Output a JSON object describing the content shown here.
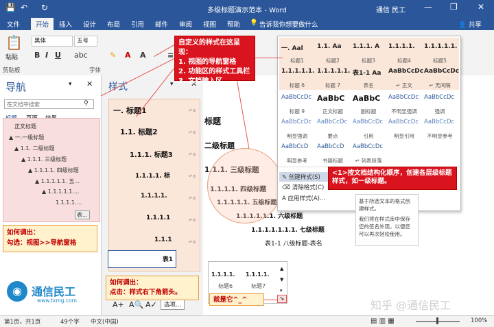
{
  "window": {
    "title": "多级标题演示范本 - Word",
    "user": "通信 民工",
    "share": "共享"
  },
  "tabs": [
    "文件",
    "开始",
    "插入",
    "设计",
    "布局",
    "引用",
    "邮件",
    "审阅",
    "视图",
    "帮助"
  ],
  "tell_me": "告诉我你想要做什么",
  "ribbon": {
    "paste": "粘贴",
    "clipboard": "剪贴板",
    "font_name": "黑体",
    "font_size": "五号",
    "font_group": "字体"
  },
  "nav_pane": {
    "title": "导航",
    "search_placeholder": "在文档中搜索",
    "tabs": [
      "标题",
      "页面",
      "结果"
    ],
    "items": [
      "正文标题",
      "▲ 一.一级标题",
      "▲ 1.1. 二级标题",
      "▲ 1.1.1. 三级标题",
      "▲ 1.1.1.1. 四级标题",
      "▲ 1.1.1.1.1. 五...",
      "▲ 1.1.1.1.1....",
      "1.1.1.1....",
      "表..."
    ]
  },
  "styles_pane": {
    "title": "样式",
    "items": [
      "一. 标题1",
      "1.1. 标题2",
      "1.1.1. 标题3",
      "1.1.1.1. 标",
      "1.1.1.1.",
      "1.1.1.1",
      "1.1.1",
      "表1"
    ],
    "options": "选项..."
  },
  "document": {
    "lines": [
      "标题",
      "二级标题",
      "1.1.1. 三级标题",
      "1.1.1.1. 四级标题",
      "1.1.1.1.1. 五级标题",
      "1.1.1.1.1.1. 六级标题",
      "1.1.1.1.1.1.1. 七级标题",
      "表1-1 八级标题-表名"
    ]
  },
  "gallery": {
    "row1": [
      {
        "preview": "一. Aal",
        "name": "标题1"
      },
      {
        "preview": "1.1. Aa",
        "name": "标题2"
      },
      {
        "preview": "1.1.1. A",
        "name": "标题3"
      },
      {
        "preview": "1.1.1.1.",
        "name": "标题4"
      },
      {
        "preview": "1.1.1.1.1.",
        "name": "标题5"
      }
    ],
    "row2": [
      {
        "preview": "1.1.1.1.1.",
        "name": "标题 6"
      },
      {
        "preview": "1.1.1.1.1.",
        "name": "标题 7"
      },
      {
        "preview": "表1-1 Aa",
        "name": "表名"
      },
      {
        "preview": "AaBbCcDc",
        "name": "↵ 正文"
      },
      {
        "preview": "AaBbCcDc",
        "name": "↵ 无间隔"
      }
    ],
    "row3": [
      {
        "preview": "AaBbCcDc",
        "name": "标题 9"
      },
      {
        "preview": "AaBbC",
        "name": "正文标题"
      },
      {
        "preview": "AaBbC",
        "name": "副标题"
      },
      {
        "preview": "AaBbCcDc",
        "name": "不明显强调"
      },
      {
        "preview": "AaBbCcDc",
        "name": "强调"
      }
    ],
    "row4": [
      {
        "preview": "AaBbCcDc",
        "name": "明显强调"
      },
      {
        "preview": "AaBbCcDc",
        "name": "要点"
      },
      {
        "preview": "AaBbCcDc",
        "name": "引用"
      },
      {
        "preview": "AaBbCcDc",
        "name": "明显引用"
      },
      {
        "preview": "AaBbCcDc",
        "name": "不明显参考"
      }
    ],
    "row5": [
      {
        "preview": "AaBbCcD",
        "name": "明显参考"
      },
      {
        "preview": "AaBbCcD",
        "name": "书籍标题"
      },
      {
        "preview": "AaBbCcDc",
        "name": "↵ 列表段落"
      }
    ],
    "menu": [
      "创建样式(S)",
      "清除格式(C)",
      "应用样式(A)..."
    ]
  },
  "tooltip": {
    "line1": "基于所选文本的格式创建样式。",
    "line2": "我们将在样式库中保存您的签名外观，以便您可以再次轻松使用。"
  },
  "small_gallery": [
    {
      "preview": "1.1.1.1.",
      "name": "标题6"
    },
    {
      "preview": "1.1.1.1.",
      "name": "标题7"
    }
  ],
  "annotations": {
    "main": "自定义的样式在这呈现：\n1. 视图的导航窗格\n2. 功能区的样式工具栏\n3. 文档输入区",
    "order": "<1>按文档结构化顺序，创建各层级标题样式，如一级标题。",
    "nav_how": "如何调出：\n勾选：视图>>导航窗格",
    "style_how": "如何调出：\n点击：样式右下角箭头。",
    "arrow": "就是它^_^"
  },
  "logo": {
    "name": "通信民工",
    "url": "www.txmg.com"
  },
  "watermark": "知乎 @通信民工",
  "status": {
    "page": "第1页，共1页",
    "words": "49个字",
    "lang": "中文(中国)",
    "zoom": "100%"
  },
  "colors": {
    "word_blue": "#2b579a",
    "anno_red": "#d9141e",
    "anno_yellow": "#ffe7b3",
    "pink": "#f8dede"
  }
}
